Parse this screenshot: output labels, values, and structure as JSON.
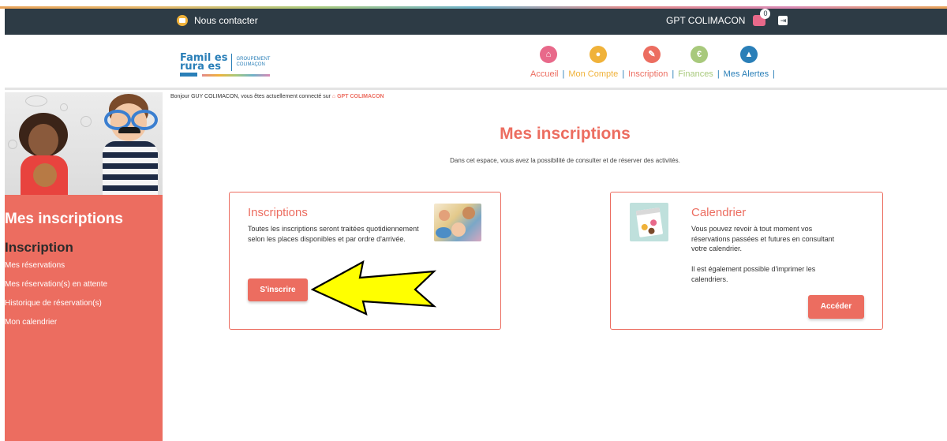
{
  "topbar": {
    "contact_label": "Nous contacter",
    "account_label": "GPT COLIMACON",
    "cart_count": "0"
  },
  "logo": {
    "line1": "Famil es",
    "line2": "rura es",
    "sub1": "GROUPEMENT",
    "sub2": "COLIMAÇON"
  },
  "nav": {
    "items": [
      {
        "label": "Accueil",
        "color": "#e8698a",
        "icon": "home-icon"
      },
      {
        "label": "Mon Compte",
        "color": "#f0b23a",
        "icon": "user-icon"
      },
      {
        "label": "Inscription",
        "color": "#ec6d60",
        "icon": "pencil-icon"
      },
      {
        "label": "Finances",
        "color": "#a8c97c",
        "icon": "euro-icon"
      },
      {
        "label": "Mes Alertes",
        "color": "#2a7fb8",
        "icon": "alert-icon"
      }
    ]
  },
  "sidebar": {
    "title": "Mes inscriptions",
    "subtitle": "Inscription",
    "links": [
      "Mes réservations",
      "Mes réservation(s) en attente",
      "Historique de réservation(s)",
      "Mon calendrier"
    ]
  },
  "main": {
    "greeting": "Bonjour GUY COLIMACON, vous êtes actuellement connecté sur",
    "greeting_site": "GPT COLIMACON",
    "title": "Mes inscriptions",
    "subtitle": "Dans cet espace, vous avez la possibilité de consulter et de réserver des activités."
  },
  "cards": {
    "inscriptions": {
      "title": "Inscriptions",
      "text": "Toutes les inscriptions seront traitées quotidiennement selon les places disponibles et par ordre d'arrivée.",
      "button": "S'inscrire"
    },
    "calendrier": {
      "title": "Calendrier",
      "text1": "Vous pouvez revoir à tout moment vos réservations passées et futures en consultant votre calendrier.",
      "text2": "Il est également possible d'imprimer les calendriers.",
      "button": "Accéder"
    }
  },
  "colors": {
    "accent": "#ec6d60",
    "topbar": "#2d3b45",
    "link_blue": "#2a7fb8",
    "arrow": "#ffff00"
  }
}
